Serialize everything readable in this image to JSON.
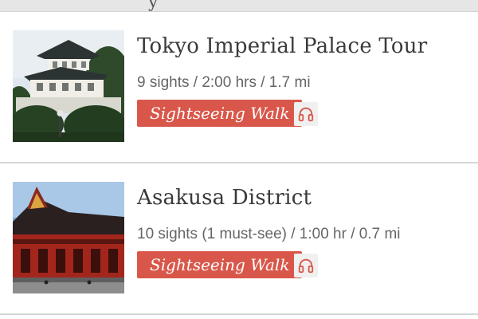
{
  "header": {
    "partial_glyph": "y"
  },
  "tours": [
    {
      "title": "Tokyo Imperial Palace Tour",
      "meta": "9 sights / 2:00 hrs / 1.7 mi",
      "tag": "Sightseeing Walk",
      "icon": "headphones-icon"
    },
    {
      "title": "Asakusa District",
      "meta": "10 sights (1 must-see) / 1:00 hr / 0.7 mi",
      "tag": "Sightseeing Walk",
      "icon": "headphones-icon"
    }
  ],
  "colors": {
    "tag_bg": "#d9574a",
    "title_text": "#3a3a3a",
    "meta_text": "#666666"
  }
}
